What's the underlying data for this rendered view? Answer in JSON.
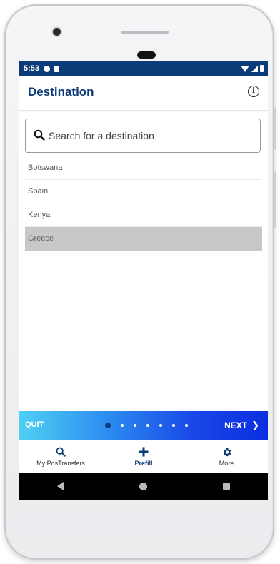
{
  "status_bar": {
    "time": "5:53"
  },
  "app_bar": {
    "title": "Destination",
    "info_icon": "info-icon"
  },
  "search": {
    "placeholder": "Search for a destination"
  },
  "destinations": [
    {
      "label": "Botswana",
      "selected": false
    },
    {
      "label": "Spain",
      "selected": false
    },
    {
      "label": "Kenya",
      "selected": false
    },
    {
      "label": "Greece",
      "selected": true
    }
  ],
  "wizard": {
    "quit_label": "QUIT",
    "next_label": "NEXT",
    "step_count": 7,
    "current_step": 1
  },
  "bottom_nav": {
    "items": [
      {
        "label": "My PosTransfers",
        "icon": "search-icon",
        "active": false
      },
      {
        "label": "Prefill",
        "icon": "plus-icon",
        "active": true
      },
      {
        "label": "More",
        "icon": "gear-icon",
        "active": false
      }
    ]
  },
  "colors": {
    "primary": "#0b3b78",
    "selected_row": "#c8c8c8",
    "wizard_gradient_start": "#4fd0f4",
    "wizard_gradient_end": "#0c2fe0"
  }
}
